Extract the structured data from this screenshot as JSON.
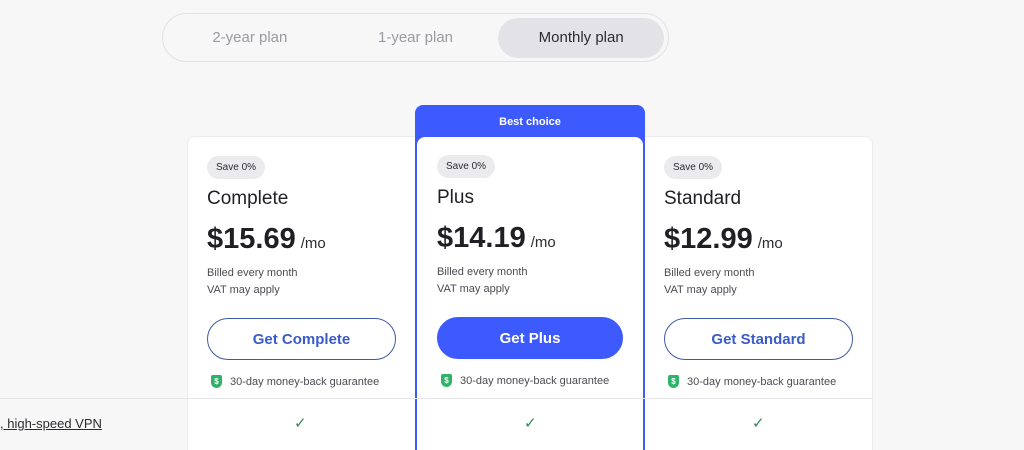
{
  "plan_toggle": {
    "tabs": [
      {
        "label": "2-year plan",
        "active": false
      },
      {
        "label": "1-year plan",
        "active": false
      },
      {
        "label": "Monthly plan",
        "active": true
      }
    ]
  },
  "highlight": {
    "label": "Best choice"
  },
  "plans": [
    {
      "badge": "Save 0%",
      "name": "Complete",
      "price": "$15.69",
      "period": "/mo",
      "billing": "Billed every month",
      "vat": "VAT may apply",
      "cta": "Get Complete",
      "guarantee": "30-day money-back guarantee"
    },
    {
      "badge": "Save 0%",
      "name": "Plus",
      "price": "$14.19",
      "period": "/mo",
      "billing": "Billed every month",
      "vat": "VAT may apply",
      "cta": "Get Plus",
      "guarantee": "30-day money-back guarantee"
    },
    {
      "badge": "Save 0%",
      "name": "Standard",
      "price": "$12.99",
      "period": "/mo",
      "billing": "Billed every month",
      "vat": "VAT may apply",
      "cta": "Get Standard",
      "guarantee": "30-day money-back guarantee"
    }
  ],
  "features": [
    {
      "label": ", high-speed VPN",
      "check": "✓"
    }
  ],
  "colors": {
    "accent": "#3d5afe",
    "guarantee_icon": "#2fb36b",
    "check": "#2d8a5a"
  }
}
